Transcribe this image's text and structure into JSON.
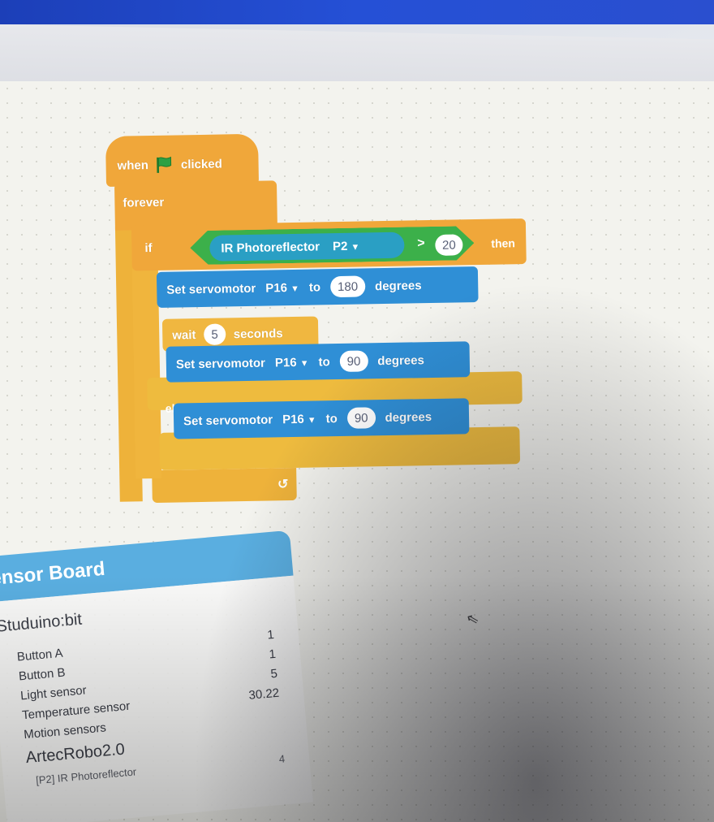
{
  "script": {
    "hat": {
      "when": "when",
      "clicked": "clicked",
      "icon": "green-flag-icon"
    },
    "forever": "forever",
    "if_block": {
      "if": "if",
      "sensor": "IR Photoreflector",
      "port": "P2",
      "operator": ">",
      "threshold": "20",
      "then": "then"
    },
    "else": "else",
    "servo_1": {
      "label": "Set servomotor",
      "port": "P16",
      "to": "to",
      "value": "180",
      "unit": "degrees"
    },
    "wait": {
      "label": "wait",
      "value": "5",
      "unit": "seconds"
    },
    "servo_2": {
      "label": "Set servomotor",
      "port": "P16",
      "to": "to",
      "value": "90",
      "unit": "degrees"
    },
    "servo_3": {
      "label": "Set servomotor",
      "port": "P16",
      "to": "to",
      "value": "90",
      "unit": "degrees"
    }
  },
  "sensor_panel": {
    "title": "ensor Board",
    "rows": [
      {
        "label": "Studuino:bit",
        "value": ""
      },
      {
        "label": "Button A",
        "value": "1"
      },
      {
        "label": "Button B",
        "value": "1"
      },
      {
        "label": "Light sensor",
        "value": "5"
      },
      {
        "label": "Temperature sensor",
        "value": "30.22"
      },
      {
        "label": "Motion sensors",
        "value": ""
      },
      {
        "label": "ArtecRobo2.0",
        "value": ""
      },
      {
        "label": "[P2] IR Photoreflector",
        "value": "4"
      }
    ]
  },
  "colors": {
    "events": "#f0a73a",
    "control": "#f0b740",
    "operator": "#3cb04a",
    "sensor": "#2a9fc4",
    "motion": "#2f8fd6",
    "panel_header": "#5aaee0"
  }
}
